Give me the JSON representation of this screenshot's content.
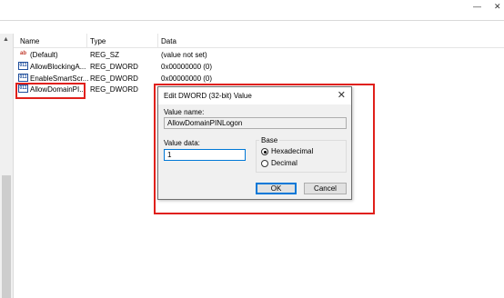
{
  "titlebar": {
    "minimize_glyph": "—",
    "close_glyph": "✕"
  },
  "list": {
    "columns": {
      "name": "Name",
      "type": "Type",
      "data": "Data"
    },
    "rows": [
      {
        "icon": "ab",
        "name": "(Default)",
        "type": "REG_SZ",
        "data": "(value not set)"
      },
      {
        "icon": "011",
        "name": "AllowBlockingA...",
        "type": "REG_DWORD",
        "data": "0x00000000 (0)"
      },
      {
        "icon": "011",
        "name": "EnableSmartScr...",
        "type": "REG_DWORD",
        "data": "0x00000000 (0)"
      },
      {
        "icon": "011",
        "name": "AllowDomainPI...",
        "type": "REG_DWORD",
        "data": ""
      }
    ]
  },
  "dialog": {
    "title": "Edit DWORD (32-bit) Value",
    "close_glyph": "✕",
    "value_name_label": "Value name:",
    "value_name": "AllowDomainPINLogon",
    "value_data_label": "Value data:",
    "value_data": "1",
    "base_label": "Base",
    "hex_label": "Hexadecimal",
    "dec_label": "Decimal",
    "ok_label": "OK",
    "cancel_label": "Cancel"
  },
  "colors": {
    "highlight": "#e0201b",
    "accent": "#0078d7"
  }
}
